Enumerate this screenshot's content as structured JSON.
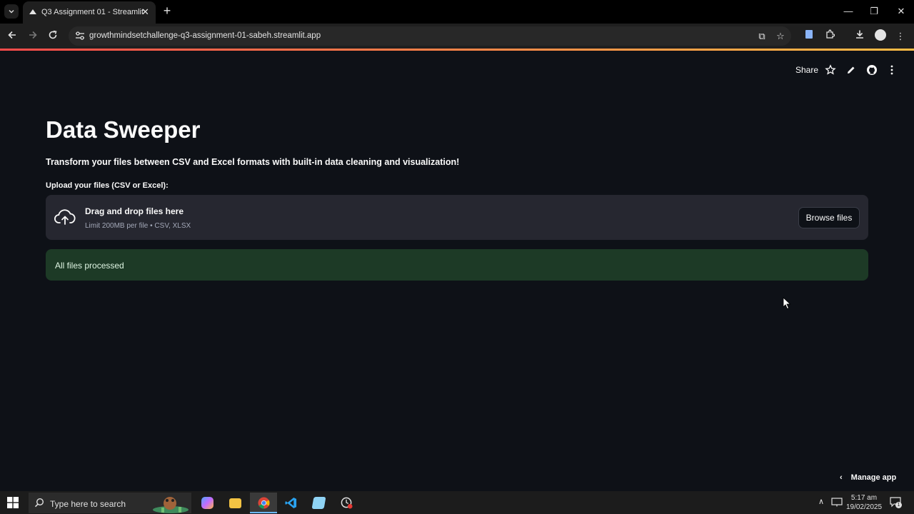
{
  "browser": {
    "tab_title": "Q3 Assignment 01 - Streamlit",
    "url": "growthmindsetchallenge-q3-assignment-01-sabeh.streamlit.app"
  },
  "header": {
    "share_label": "Share"
  },
  "main": {
    "title": "Data Sweeper",
    "subtitle": "Transform your files between CSV and Excel formats with built-in data cleaning and visualization!",
    "upload_label": "Upload your files (CSV or Excel):",
    "dropzone": {
      "main_text": "Drag and drop files here",
      "limit_text": "Limit 200MB per file • CSV, XLSX",
      "browse_label": "Browse files"
    },
    "success_message": "All files processed"
  },
  "footer": {
    "manage_app_label": "Manage app"
  },
  "taskbar": {
    "search_placeholder": "Type here to search",
    "time": "5:17 am",
    "date": "19/02/2025",
    "notification_count": "1"
  },
  "colors": {
    "app_bg": "#0e1117",
    "dropzone_bg": "#262730",
    "success_bg": "#1d3a26",
    "accent_red": "#ff4b4b"
  }
}
